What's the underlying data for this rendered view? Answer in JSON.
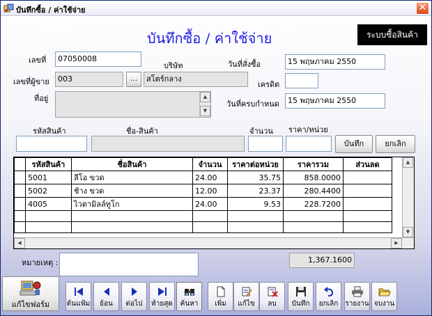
{
  "window": {
    "title": "บันทึกซื้อ / ค่าใช้จ่าย",
    "close_glyph": "✕"
  },
  "header": {
    "title": "บันทึกซื้อ / ค่าใช้จ่าย",
    "badge": "ระบบซื้อสินค้า"
  },
  "form": {
    "doc_no_label": "เลขที่",
    "doc_no_value": "07050008",
    "company_label": "บริษัท",
    "order_date_label": "วันที่สั่งซื้อ",
    "order_date_value": "15 พฤษภาคม 2550",
    "vendor_no_label": "เลขที่ผู้ขาย",
    "vendor_no_value": "003",
    "lookup_label": "...",
    "vendor_name_value": "สโตร์กลาง",
    "credit_label": "เครดิต",
    "credit_value": "",
    "address_label": "ที่อยู่",
    "address_value": "",
    "due_date_label": "วันที่ครบกำหนด",
    "due_date_value": "15 พฤษภาคม 2550"
  },
  "entry": {
    "product_code_label": "รหัสสินค้า",
    "product_code_value": "",
    "product_name_label": "ชื่อ-สินค้า",
    "product_name_value": "",
    "qty_label": "จำนวน",
    "qty_value": "",
    "unit_price_label": "ราคา/หน่วย",
    "unit_price_value": "",
    "save_label": "บันทึก",
    "cancel_label": "ยกเลิก"
  },
  "grid": {
    "columns": [
      "รหัสสินค้า",
      "ชื่อสินค้า",
      "จำนวน",
      "ราคาต่อหน่วย",
      "ราคารวม",
      "ส่วนลด"
    ],
    "rows": [
      [
        "5001",
        "ลีโอ ขวด",
        "24.00",
        "35.75",
        "858.0000",
        ""
      ],
      [
        "5002",
        "ช้าง ขวด",
        "12.00",
        "23.37",
        "280.4400",
        ""
      ],
      [
        "4005",
        "ไวตามิลล์ทูโก",
        "24.00",
        "9.53",
        "228.7200",
        ""
      ]
    ]
  },
  "footer": {
    "remarks_label": "หมายเหตุ :",
    "remarks_value": "",
    "total_value": "1,367.1600",
    "edit_form_label": "แก้ไขฟอร์ม"
  },
  "toolbar": {
    "first": "ต้นแฟ้ม",
    "prev": "ย้อน",
    "next": "ต่อไป",
    "last": "ท้ายสุด",
    "search": "ค้นหา",
    "add": "เพิ่ม",
    "edit": "แก้ไข",
    "delete": "ลบ",
    "save": "บันทึก",
    "cancel": "ยกเลิก",
    "report": "รายงาน",
    "exit": "จบงาน"
  },
  "colors": {
    "title_blue": "#1d1de0",
    "badge_bg": "#000000",
    "nav_blue": "#1a2fb0"
  }
}
